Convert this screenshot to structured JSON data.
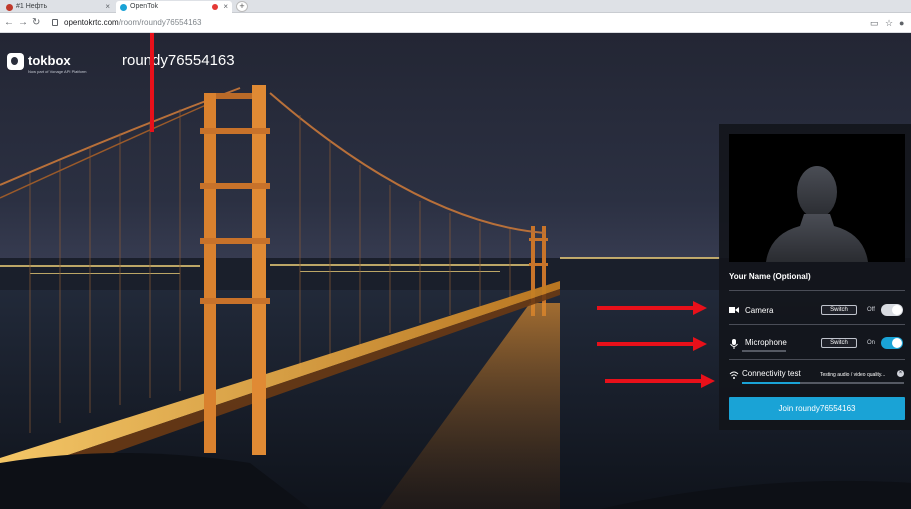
{
  "browser": {
    "tabs": [
      {
        "label": "#1 Нефть",
        "active": false
      },
      {
        "label": "OpenTok",
        "active": true
      }
    ],
    "new_tab_label": "+",
    "url_host": "opentokrtc.com",
    "url_path": "/room/roundy76554163"
  },
  "page": {
    "logo_text": "tokbox",
    "logo_tagline": "Now part of Vonage API Platform",
    "room_title": "roundy76554163"
  },
  "panel": {
    "name_label": "Your Name (Optional)",
    "camera": {
      "label": "Camera",
      "switch_label": "Switch",
      "state_label": "Off",
      "enabled": false
    },
    "microphone": {
      "label": "Microphone",
      "switch_label": "Switch",
      "state_label": "On",
      "enabled": true
    },
    "connectivity": {
      "label": "Connectivity test",
      "status": "Testing audio / video quality...",
      "progress": 0.36
    },
    "join_label": "Join roundy76554163"
  },
  "colors": {
    "accent": "#1aa3d6",
    "annotation_arrow": "#e8101a"
  },
  "icons": {
    "camera": "video-camera-icon",
    "microphone": "microphone-icon",
    "connectivity": "wifi-icon",
    "close": "close-icon"
  }
}
